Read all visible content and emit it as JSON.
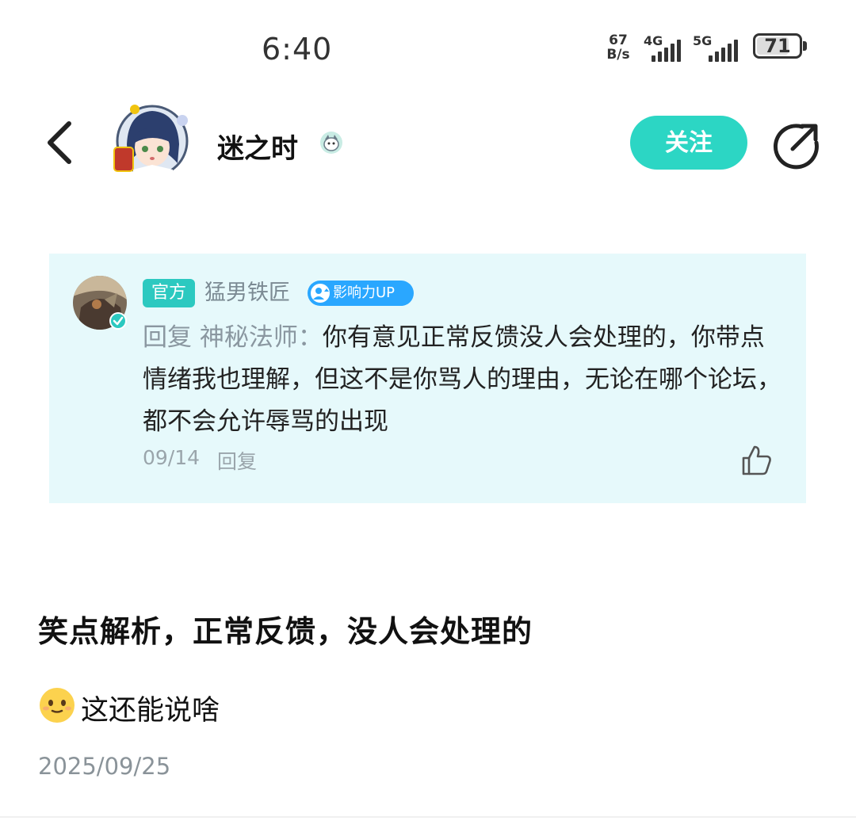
{
  "status_bar": {
    "time": "6:40",
    "net_speed_value": "67",
    "net_speed_unit": "B/s",
    "signal1_label": "4G",
    "signal2_label": "5G",
    "battery_level": "71"
  },
  "header": {
    "username": "迷之时",
    "follow_label": "关注"
  },
  "quoted_reply": {
    "official_tag": "官方",
    "author": "猛男铁匠",
    "influence_tag": "影响力UP",
    "reply_prefix": "回复 神秘法师：",
    "content": "你有意见正常反馈没人会处理的，你带点情绪我也理解，但这不是你骂人的理由，无论在哪个论坛，都不会允许辱骂的出现",
    "date": "09/14",
    "reply_label": "回复"
  },
  "post": {
    "headline": "笑点解析，正常反馈，没人会处理的",
    "subtext": "这还能说啥",
    "date": "2025/09/25"
  },
  "colors": {
    "accent": "#2cd6c4",
    "card_bg": "#e6f9fb",
    "official_tag": "#2cc9c0",
    "influence_tag": "#2aa7ff"
  },
  "icons": [
    "back-arrow-icon",
    "share-icon",
    "like-thumb-icon",
    "verified-icon",
    "emoji-smile-icon",
    "user-badge-icon"
  ]
}
